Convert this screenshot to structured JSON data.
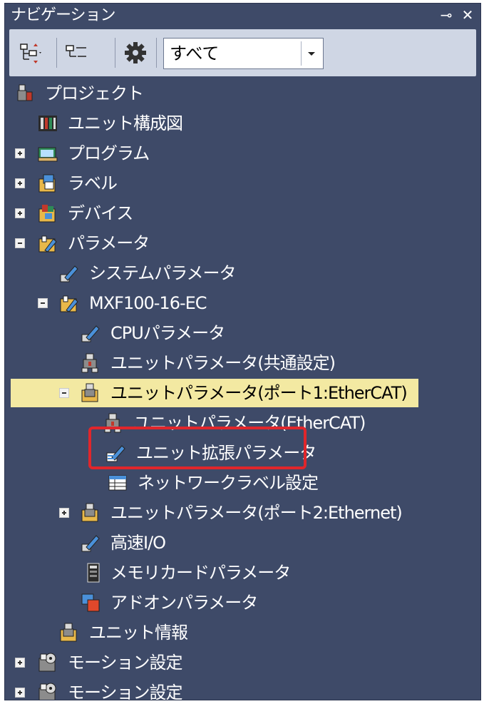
{
  "window": {
    "title": "ナビゲーション",
    "pin_glyph": "⊸",
    "close_glyph": "✕"
  },
  "toolbar": {
    "filter_value": "すべて"
  },
  "tree": {
    "project": "プロジェクト",
    "unit_config": "ユニット構成図",
    "program": "プログラム",
    "label": "ラベル",
    "device": "デバイス",
    "parameter": "パラメータ",
    "system_parameter": "システムパラメータ",
    "module": "MXF100-16-EC",
    "cpu_parameter": "CPUパラメータ",
    "unit_parameter_common": "ユニットパラメータ(共通設定)",
    "unit_parameter_port1": "ユニットパラメータ(ポート1:EtherCAT)",
    "unit_parameter_ethercat": "ユニットパラメータ(EtherCAT)",
    "unit_extended_parameter": "ユニット拡張パラメータ",
    "network_label_setting": "ネットワークラベル設定",
    "unit_parameter_port2": "ユニットパラメータ(ポート2:Ethernet)",
    "high_speed_io": "高速I/O",
    "memory_card_parameter": "メモリカードパラメータ",
    "addon_parameter": "アドオンパラメータ",
    "unit_info": "ユニット情報",
    "motion_setting_1": "モーション設定",
    "motion_setting_2": "モーション設定"
  },
  "colors": {
    "panel_bg": "#3e4a68",
    "selected_row": "#f3e9a2",
    "highlight_border": "#e0262b"
  }
}
